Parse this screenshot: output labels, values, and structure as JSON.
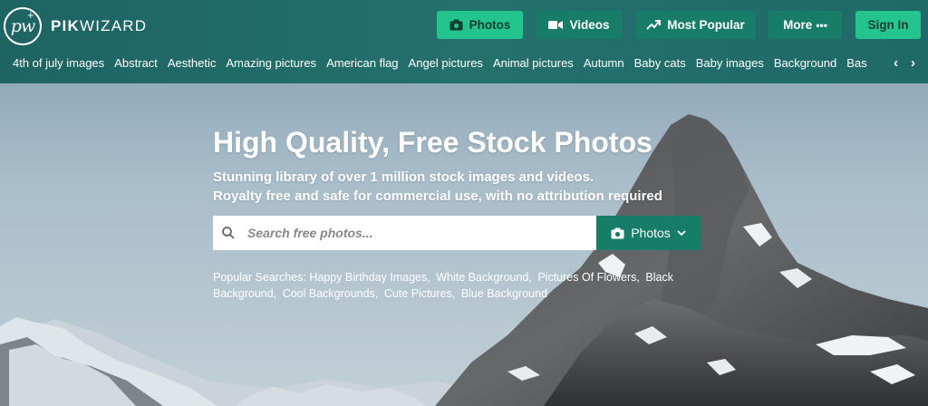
{
  "brand": {
    "logo_mark": "pw",
    "name_bold": "PIK",
    "name_light": "WIZARD"
  },
  "nav": {
    "photos": {
      "label": "Photos",
      "icon": "camera-icon",
      "active": true
    },
    "videos": {
      "label": "Videos",
      "icon": "video-camera-icon"
    },
    "most_popular": {
      "label": "Most Popular",
      "icon": "trending-up-icon"
    },
    "more": {
      "label": "More",
      "icon": "ellipsis-icon"
    },
    "sign_in": {
      "label": "Sign In"
    }
  },
  "categories": [
    "4th of july images",
    "Abstract",
    "Aesthetic",
    "Amazing pictures",
    "American flag",
    "Angel pictures",
    "Animal pictures",
    "Autumn",
    "Baby cats",
    "Baby images",
    "Background",
    "Bas"
  ],
  "hero": {
    "title": "High Quality, Free Stock Photos",
    "subtitle_line1": "Stunning library of over 1 million stock images and videos.",
    "subtitle_line2": "Royalty free and safe for commercial use, with no attribution required"
  },
  "search": {
    "placeholder": "Search free photos...",
    "value": "",
    "type_label": "Photos"
  },
  "popular": {
    "label": "Popular Searches:",
    "items": [
      "Happy Birthday Images",
      "White Background",
      "Pictures Of Flowers",
      "Black Background",
      "Cool Backgrounds",
      "Cute Pictures",
      "Blue Background"
    ]
  },
  "colors": {
    "header_bg": "#1f6a69",
    "button_bg": "#177d68",
    "active_button_bg": "#23c48e"
  }
}
